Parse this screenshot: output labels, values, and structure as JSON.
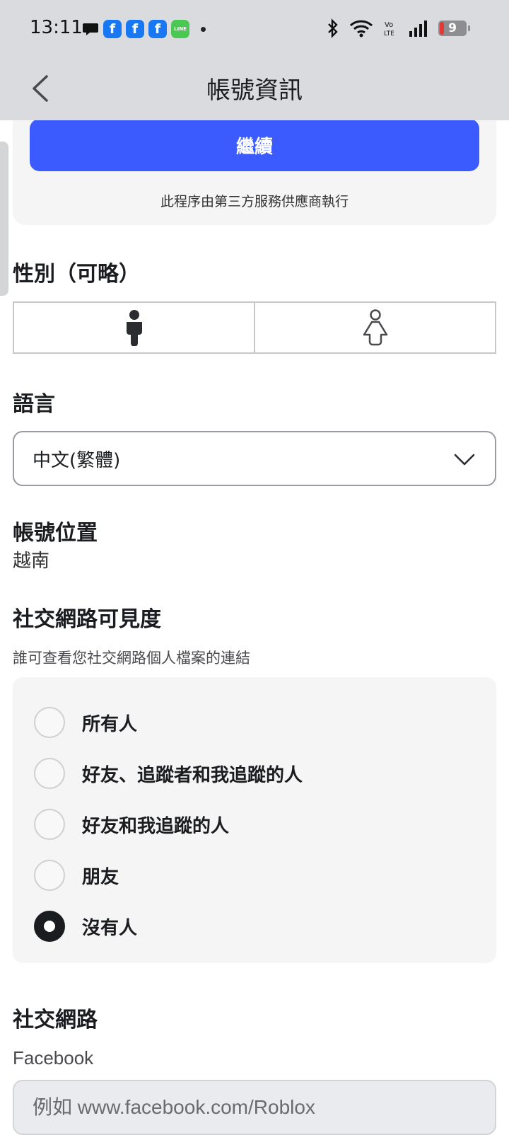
{
  "status_bar": {
    "time": "13:11",
    "battery": "9",
    "notification_icons": [
      "message-icon",
      "facebook-icon",
      "facebook-icon",
      "facebook-icon",
      "line-icon"
    ],
    "line_icon_text": "LINE",
    "facebook_glyph": "f",
    "volte_text": "Vo LTE"
  },
  "header": {
    "title": "帳號資訊"
  },
  "verification": {
    "continue_label": "繼續",
    "note": "此程序由第三方服務供應商執行",
    "button_color": "#3b5bff"
  },
  "gender": {
    "title": "性別（可略）",
    "options": [
      "male-icon",
      "female-icon"
    ]
  },
  "language": {
    "title": "語言",
    "selected": "中文(繁體)"
  },
  "location": {
    "title": "帳號位置",
    "value": "越南"
  },
  "social_visibility": {
    "title": "社交網路可見度",
    "description": "誰可查看您社交網路個人檔案的連結",
    "options": [
      {
        "label": "所有人",
        "selected": false
      },
      {
        "label": "好友、追蹤者和我追蹤的人",
        "selected": false
      },
      {
        "label": "好友和我追蹤的人",
        "selected": false
      },
      {
        "label": "朋友",
        "selected": false
      },
      {
        "label": "沒有人",
        "selected": true
      }
    ]
  },
  "social_networks": {
    "title": "社交網路",
    "facebook_label": "Facebook",
    "facebook_placeholder": "例如 www.facebook.com/Roblox"
  }
}
